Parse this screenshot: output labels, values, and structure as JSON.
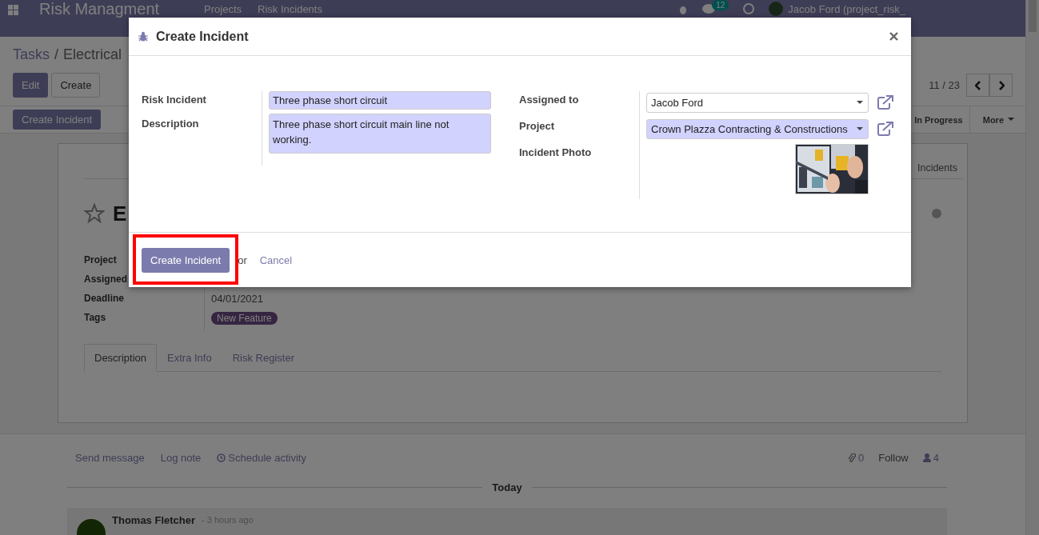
{
  "navbar": {
    "brand": "Risk Managment",
    "menu": [
      "Projects",
      "Risk Incidents"
    ],
    "chat_badge": "12",
    "user": "Jacob Ford (project_risk_"
  },
  "breadcrumb": {
    "items": [
      "Tasks",
      "Electrical"
    ],
    "separator": "/"
  },
  "buttons": [
    "Edit",
    "Create"
  ],
  "pager": "11 / 23",
  "header_button": "Create Incident",
  "stages": [
    "In Progress"
  ],
  "more": "More",
  "smart_button": "Incidents",
  "title": "E",
  "fields": [
    {
      "label": "Project"
    },
    {
      "label": "Assigned"
    },
    {
      "label": "Deadline",
      "value": "04/01/2021"
    },
    {
      "label": "Tags",
      "tag": "New Feature"
    }
  ],
  "tabs": [
    {
      "label": "Description",
      "selected": true
    },
    {
      "label": "Extra Info",
      "selected": false
    },
    {
      "label": "Risk Register",
      "selected": false
    }
  ],
  "chatter": {
    "actions": [
      "Send message",
      "Log note",
      "Schedule activity"
    ],
    "attachments": "0",
    "follow": "Follow",
    "followers": "4",
    "separator": "Today",
    "messages": [
      {
        "author": "Thomas Fletcher",
        "time": "- 3 hours ago"
      }
    ]
  },
  "dialog": {
    "title": "Create Incident",
    "left_fields": [
      {
        "label": "Risk Incident",
        "kind": "input",
        "value": "Three phase short circuit",
        "required": true
      },
      {
        "label": "Description",
        "kind": "textarea",
        "value": "Three phase short circuit main line not working.",
        "required": true
      }
    ],
    "right_fields": [
      {
        "label": "Assigned to",
        "kind": "select",
        "value": "Jacob Ford",
        "required": false
      },
      {
        "label": "Project",
        "kind": "select",
        "value": "Crown Plazza Contracting & Constructions",
        "required": true
      },
      {
        "label": "Incident Photo"
      }
    ],
    "primary_button": {
      "label": "Create Incident",
      "highlighted": true
    },
    "or": "or",
    "cancel": "Cancel"
  }
}
